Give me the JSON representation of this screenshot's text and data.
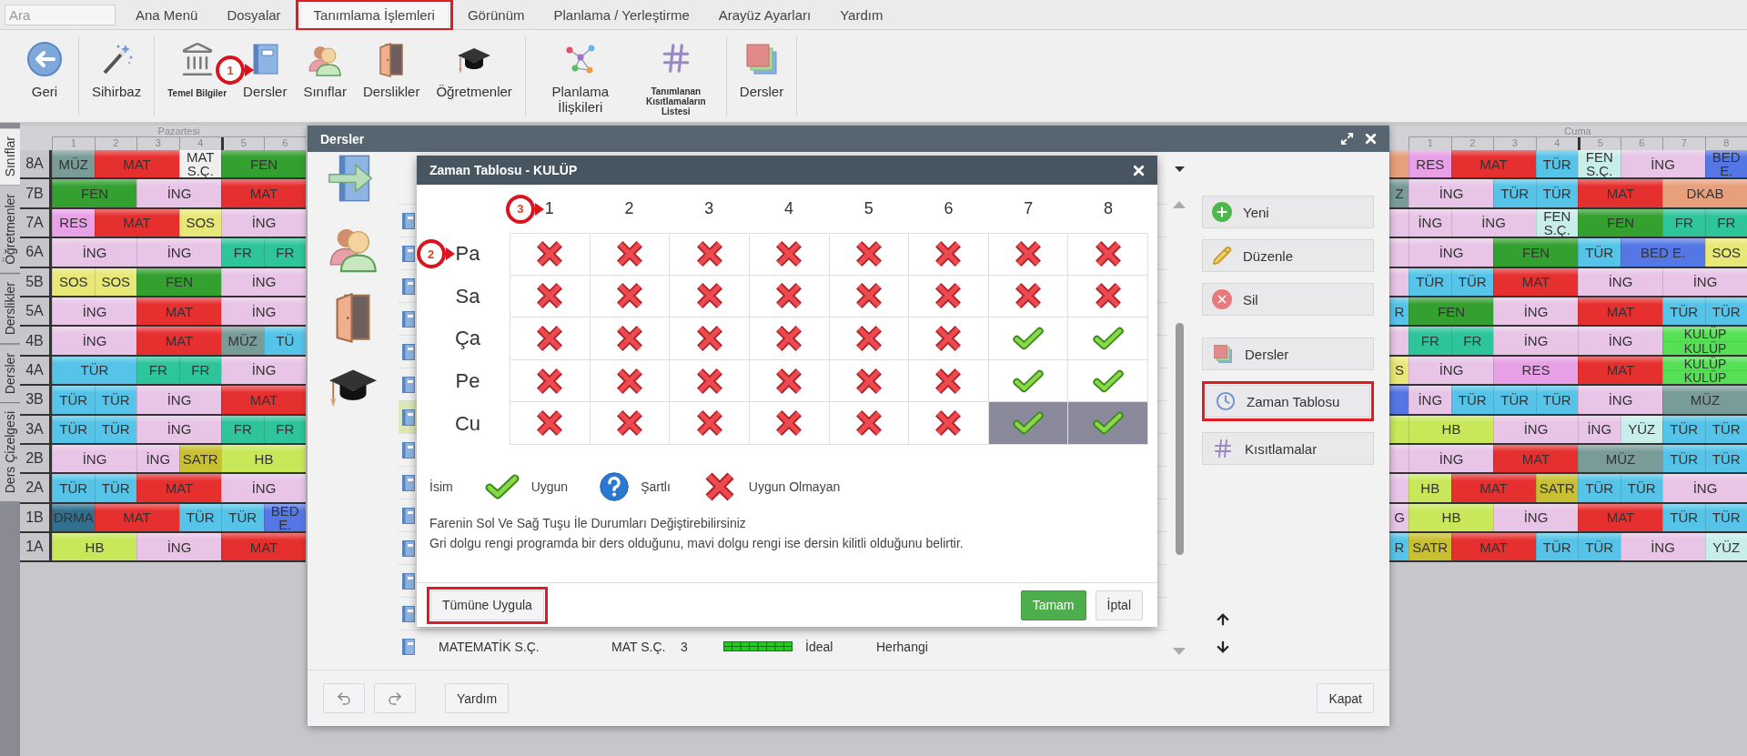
{
  "menu": {
    "search": {
      "placeholder": "Ara"
    },
    "items": [
      {
        "label": "Ana Menü",
        "selected": false,
        "highlighted": false
      },
      {
        "label": "Dosyalar",
        "selected": false,
        "highlighted": false
      },
      {
        "label": "Tanımlama İşlemleri",
        "selected": true,
        "highlighted": true
      },
      {
        "label": "Görünüm",
        "selected": false,
        "highlighted": false
      },
      {
        "label": "Planlama / Yerleştirme",
        "selected": false,
        "highlighted": false
      },
      {
        "label": "Arayüz Ayarları",
        "selected": false,
        "highlighted": false
      },
      {
        "label": "Yardım",
        "selected": false,
        "highlighted": false
      }
    ]
  },
  "toolbar": {
    "groups": [
      {
        "items": [
          {
            "label": "Geri",
            "kind": "back"
          }
        ]
      },
      {
        "items": [
          {
            "label": "Sihirbaz",
            "kind": "wizard"
          }
        ]
      },
      {
        "items": [
          {
            "label": "Temel Bilgiler",
            "kind": "institution",
            "compact": true
          },
          {
            "label": "Dersler",
            "kind": "book",
            "marker": "1"
          },
          {
            "label": "Sınıflar",
            "kind": "people"
          },
          {
            "label": "Derslikler",
            "kind": "door"
          },
          {
            "label": "Öğretmenler",
            "kind": "cap"
          }
        ]
      },
      {
        "items": [
          {
            "label": "Planlama İlişkileri",
            "kind": "network"
          },
          {
            "label": "Tanımlanan Kısıtlamaların Listesi",
            "kind": "grid",
            "compact": true
          }
        ]
      },
      {
        "items": [
          {
            "label": "Dersler",
            "kind": "stack"
          }
        ]
      }
    ]
  },
  "side_tabs": [
    {
      "label": "Sınıflar",
      "selected": true
    },
    {
      "label": "Öğretmenler",
      "selected": false
    },
    {
      "label": "Derslikler",
      "selected": false
    },
    {
      "label": "Dersler",
      "selected": false
    },
    {
      "label": "Ders Çizelgesi",
      "selected": false
    }
  ],
  "timetable": {
    "days": [
      {
        "name": "Pazartesi",
        "periods": [
          "1",
          "2",
          "3",
          "4",
          "5",
          "6"
        ]
      },
      {
        "name": "Cuma",
        "periods": [
          "1",
          "2",
          "3",
          "4",
          "5",
          "6",
          "7",
          "8"
        ]
      }
    ],
    "rows": [
      {
        "class": "8A",
        "pazartesi": [
          {
            "text": "MÜZ",
            "color": "#7a9c98",
            "kind": "single"
          },
          {
            "text": "MAT",
            "color": "#e63030",
            "kind": "double"
          },
          {
            "text": "MAT S.Ç.",
            "color": "#efefef",
            "kind": "single"
          },
          {
            "text": "FEN",
            "color": "#33a02f",
            "kind": "double"
          }
        ],
        "partial": {
          "color": "#e8a07c"
        },
        "cuma": [
          {
            "text": "RES",
            "color": "#e8a0e6",
            "kind": "single"
          },
          {
            "text": "MAT",
            "color": "#e63030",
            "kind": "double"
          },
          {
            "text": "TÜR",
            "color": "#55c4e8",
            "kind": "single"
          },
          {
            "text": "FEN S.Ç.",
            "color": "#c8eeea",
            "kind": "single"
          },
          {
            "text": "İNG",
            "color": "#e8c4e6",
            "kind": "double"
          },
          {
            "text": "BED E.",
            "color": "#5577e6",
            "kind": "single"
          }
        ]
      },
      {
        "class": "7B",
        "pazartesi": [
          {
            "text": "FEN",
            "color": "#33a02f",
            "kind": "double"
          },
          {
            "text": "İNG",
            "color": "#e8c4e6",
            "kind": "double"
          },
          {
            "text": "MAT",
            "color": "#e63030",
            "kind": "double"
          }
        ],
        "partial": {
          "text": "Z",
          "color": "#7a9c98"
        },
        "cuma": [
          {
            "text": "İNG",
            "color": "#e8c4e6",
            "kind": "double"
          },
          {
            "text": "TÜR",
            "color": "#55c4e8",
            "kind": "single"
          },
          {
            "text": "TÜR",
            "color": "#55c4e8",
            "kind": "single"
          },
          {
            "text": "MAT",
            "color": "#e63030",
            "kind": "double"
          },
          {
            "text": "DKAB",
            "color": "#e8a07c",
            "kind": "double"
          }
        ]
      },
      {
        "class": "7A",
        "pazartesi": [
          {
            "text": "RES",
            "color": "#e8a0e6",
            "kind": "single"
          },
          {
            "text": "MAT",
            "color": "#e63030",
            "kind": "double"
          },
          {
            "text": "SOS",
            "color": "#e8e878",
            "kind": "single"
          },
          {
            "text": "İNG",
            "color": "#e8c4e6",
            "kind": "double"
          }
        ],
        "partial": {
          "color": "#e8c4e6"
        },
        "cuma": [
          {
            "text": "İNG",
            "color": "#e8c4e6",
            "kind": "single"
          },
          {
            "text": "İNG",
            "color": "#e8c4e6",
            "kind": "double"
          },
          {
            "text": "FEN S.Ç.",
            "color": "#c8eeea",
            "kind": "single"
          },
          {
            "text": "FEN",
            "color": "#33a02f",
            "kind": "double"
          },
          {
            "text": "FR",
            "color": "#2ec49c",
            "kind": "single"
          },
          {
            "text": "FR",
            "color": "#2ec49c",
            "kind": "single"
          }
        ]
      },
      {
        "class": "6A",
        "pazartesi": [
          {
            "text": "İNG",
            "color": "#e8c4e6",
            "kind": "double"
          },
          {
            "text": "İNG",
            "color": "#e8c4e6",
            "kind": "double"
          },
          {
            "text": "FR",
            "color": "#2ec49c",
            "kind": "single"
          },
          {
            "text": "FR",
            "color": "#2ec49c",
            "kind": "single"
          }
        ],
        "partial": {
          "color": "#e8c4e6"
        },
        "cuma": [
          {
            "text": "İNG",
            "color": "#e8c4e6",
            "kind": "double"
          },
          {
            "text": "FEN",
            "color": "#33a02f",
            "kind": "double"
          },
          {
            "text": "TÜR",
            "color": "#55c4e8",
            "kind": "single"
          },
          {
            "text": "BED E.",
            "color": "#5577e6",
            "kind": "double"
          },
          {
            "text": "SOS",
            "color": "#e8e878",
            "kind": "single"
          }
        ]
      },
      {
        "class": "5B",
        "pazartesi": [
          {
            "text": "SOS",
            "color": "#e8e878",
            "kind": "single"
          },
          {
            "text": "SOS",
            "color": "#e8e878",
            "kind": "single"
          },
          {
            "text": "FEN",
            "color": "#33a02f",
            "kind": "double"
          },
          {
            "text": "İNG",
            "color": "#e8c4e6",
            "kind": "double"
          }
        ],
        "partial": {
          "color": "#e8c4e6"
        },
        "cuma": [
          {
            "text": "TÜR",
            "color": "#55c4e8",
            "kind": "single"
          },
          {
            "text": "TÜR",
            "color": "#55c4e8",
            "kind": "single"
          },
          {
            "text": "MAT",
            "color": "#e63030",
            "kind": "double"
          },
          {
            "text": "İNG",
            "color": "#e8c4e6",
            "kind": "double"
          },
          {
            "text": "İNG",
            "color": "#e8c4e6",
            "kind": "double"
          }
        ]
      },
      {
        "class": "5A",
        "pazartesi": [
          {
            "text": "İNG",
            "color": "#e8c4e6",
            "kind": "double"
          },
          {
            "text": "MAT",
            "color": "#e63030",
            "kind": "double"
          },
          {
            "text": "İNG",
            "color": "#e8c4e6",
            "kind": "double"
          }
        ],
        "partial": {
          "text": "R",
          "color": "#55c4e8"
        },
        "cuma": [
          {
            "text": "FEN",
            "color": "#33a02f",
            "kind": "double"
          },
          {
            "text": "İNG",
            "color": "#e8c4e6",
            "kind": "double"
          },
          {
            "text": "MAT",
            "color": "#e63030",
            "kind": "double"
          },
          {
            "text": "TÜR",
            "color": "#55c4e8",
            "kind": "single"
          },
          {
            "text": "TÜR",
            "color": "#55c4e8",
            "kind": "single"
          }
        ]
      },
      {
        "class": "4B",
        "pazartesi": [
          {
            "text": "İNG",
            "color": "#e8c4e6",
            "kind": "double"
          },
          {
            "text": "MAT",
            "color": "#e63030",
            "kind": "double"
          },
          {
            "text": "MÜZ",
            "color": "#7a9c98",
            "kind": "single"
          },
          {
            "text": "TÜ",
            "color": "#55c4e8",
            "kind": "single"
          }
        ],
        "partial": {
          "color": "#e8c4e6"
        },
        "cuma": [
          {
            "text": "FR",
            "color": "#2ec49c",
            "kind": "single"
          },
          {
            "text": "FR",
            "color": "#2ec49c",
            "kind": "single"
          },
          {
            "text": "İNG",
            "color": "#e8c4e6",
            "kind": "double"
          },
          {
            "text": "İNG",
            "color": "#e8c4e6",
            "kind": "double"
          },
          {
            "texts": [
              "KULÜP",
              "KULÜP"
            ],
            "color": "#55e055",
            "kind": "stacked"
          }
        ]
      },
      {
        "class": "4A",
        "pazartesi": [
          {
            "text": "TÜR",
            "color": "#55c4e8",
            "kind": "double"
          },
          {
            "text": "FR",
            "color": "#2ec49c",
            "kind": "single"
          },
          {
            "text": "FR",
            "color": "#2ec49c",
            "kind": "single"
          },
          {
            "text": "İNG",
            "color": "#e8c4e6",
            "kind": "double"
          }
        ],
        "partial": {
          "text": "S",
          "color": "#e8e878"
        },
        "cuma": [
          {
            "text": "İNG",
            "color": "#e8c4e6",
            "kind": "double"
          },
          {
            "text": "RES",
            "color": "#e8a0e6",
            "kind": "double"
          },
          {
            "text": "MAT",
            "color": "#e63030",
            "kind": "double"
          },
          {
            "texts": [
              "KULÜP",
              "KULÜP"
            ],
            "color": "#55e055",
            "kind": "stacked"
          }
        ]
      },
      {
        "class": "3B",
        "pazartesi": [
          {
            "text": "TÜR",
            "color": "#55c4e8",
            "kind": "single"
          },
          {
            "text": "TÜR",
            "color": "#55c4e8",
            "kind": "single"
          },
          {
            "text": "İNG",
            "color": "#e8c4e6",
            "kind": "double"
          },
          {
            "text": "MAT",
            "color": "#e63030",
            "kind": "double"
          }
        ],
        "partial": {
          "color": "#5577e6"
        },
        "cuma": [
          {
            "text": "İNG",
            "color": "#e8c4e6",
            "kind": "single"
          },
          {
            "text": "TÜR",
            "color": "#55c4e8",
            "kind": "single"
          },
          {
            "text": "TÜR",
            "color": "#55c4e8",
            "kind": "single"
          },
          {
            "text": "TÜR",
            "color": "#55c4e8",
            "kind": "single"
          },
          {
            "text": "İNG",
            "color": "#e8c4e6",
            "kind": "double"
          },
          {
            "text": "MÜZ",
            "color": "#7a9c98",
            "kind": "double"
          }
        ]
      },
      {
        "class": "3A",
        "pazartesi": [
          {
            "text": "TÜR",
            "color": "#55c4e8",
            "kind": "single"
          },
          {
            "text": "TÜR",
            "color": "#55c4e8",
            "kind": "single"
          },
          {
            "text": "İNG",
            "color": "#e8c4e6",
            "kind": "double"
          },
          {
            "text": "FR",
            "color": "#2ec49c",
            "kind": "single"
          },
          {
            "text": "FR",
            "color": "#2ec49c",
            "kind": "single"
          }
        ],
        "partial": {
          "color": "#c8e85a"
        },
        "cuma": [
          {
            "text": "HB",
            "color": "#c8e85a",
            "kind": "double"
          },
          {
            "text": "İNG",
            "color": "#e8c4e6",
            "kind": "double"
          },
          {
            "text": "İNG",
            "color": "#e8c4e6",
            "kind": "single"
          },
          {
            "text": "YÜZ",
            "color": "#c8eeea",
            "kind": "single"
          },
          {
            "text": "TÜR",
            "color": "#55c4e8",
            "kind": "single"
          },
          {
            "text": "TÜR",
            "color": "#55c4e8",
            "kind": "single"
          }
        ]
      },
      {
        "class": "2B",
        "pazartesi": [
          {
            "text": "İNG",
            "color": "#e8c4e6",
            "kind": "double"
          },
          {
            "text": "İNG",
            "color": "#e8c4e6",
            "kind": "single"
          },
          {
            "text": "SATR",
            "color": "#c8c030",
            "kind": "single"
          },
          {
            "text": "HB",
            "color": "#c8e85a",
            "kind": "double"
          }
        ],
        "partial": {
          "color": "#e8c4e6"
        },
        "cuma": [
          {
            "text": "İNG",
            "color": "#e8c4e6",
            "kind": "double"
          },
          {
            "text": "MAT",
            "color": "#e63030",
            "kind": "double"
          },
          {
            "text": "MÜZ",
            "color": "#7a9c98",
            "kind": "double"
          },
          {
            "text": "TÜR",
            "color": "#55c4e8",
            "kind": "single"
          },
          {
            "text": "TÜR",
            "color": "#55c4e8",
            "kind": "single"
          }
        ]
      },
      {
        "class": "2A",
        "pazartesi": [
          {
            "text": "TÜR",
            "color": "#55c4e8",
            "kind": "single"
          },
          {
            "text": "TÜR",
            "color": "#55c4e8",
            "kind": "single"
          },
          {
            "text": "MAT",
            "color": "#e63030",
            "kind": "double"
          },
          {
            "text": "İNG",
            "color": "#e8c4e6",
            "kind": "double"
          }
        ],
        "partial": {
          "color": "#e8c4e6"
        },
        "cuma": [
          {
            "text": "HB",
            "color": "#c8e85a",
            "kind": "single"
          },
          {
            "text": "MAT",
            "color": "#e63030",
            "kind": "double"
          },
          {
            "text": "SATR",
            "color": "#c8c030",
            "kind": "single"
          },
          {
            "text": "TÜR",
            "color": "#55c4e8",
            "kind": "single"
          },
          {
            "text": "TÜR",
            "color": "#55c4e8",
            "kind": "single"
          },
          {
            "text": "İNG",
            "color": "#e8c4e6",
            "kind": "double"
          }
        ]
      },
      {
        "class": "1B",
        "pazartesi": [
          {
            "text": "DRMA",
            "color": "#2f6f8f",
            "kind": "single"
          },
          {
            "text": "MAT",
            "color": "#e63030",
            "kind": "double"
          },
          {
            "text": "TÜR",
            "color": "#55c4e8",
            "kind": "single"
          },
          {
            "text": "TÜR",
            "color": "#55c4e8",
            "kind": "single"
          },
          {
            "text": "BED E.",
            "color": "#5577e6",
            "kind": "single"
          }
        ],
        "partial": {
          "text": "G",
          "color": "#e8c4e6"
        },
        "cuma": [
          {
            "text": "HB",
            "color": "#c8e85a",
            "kind": "double"
          },
          {
            "text": "İNG",
            "color": "#e8c4e6",
            "kind": "double"
          },
          {
            "text": "MAT",
            "color": "#e63030",
            "kind": "double"
          },
          {
            "text": "TÜR",
            "color": "#55c4e8",
            "kind": "single"
          },
          {
            "text": "TÜR",
            "color": "#55c4e8",
            "kind": "single"
          }
        ]
      },
      {
        "class": "1A",
        "pazartesi": [
          {
            "text": "HB",
            "color": "#c8e85a",
            "kind": "double"
          },
          {
            "text": "İNG",
            "color": "#e8c4e6",
            "kind": "double"
          },
          {
            "text": "MAT",
            "color": "#e63030",
            "kind": "double"
          }
        ],
        "partial": {
          "text": "R",
          "color": "#55c4e8"
        },
        "cuma": [
          {
            "text": "SATR",
            "color": "#c8c030",
            "kind": "single"
          },
          {
            "text": "MAT",
            "color": "#e63030",
            "kind": "double"
          },
          {
            "text": "TÜR",
            "color": "#55c4e8",
            "kind": "single"
          },
          {
            "text": "TÜR",
            "color": "#55c4e8",
            "kind": "single"
          },
          {
            "text": "İNG",
            "color": "#e8c4e6",
            "kind": "double"
          },
          {
            "text": "YÜZ",
            "color": "#c8eeea",
            "kind": "single"
          }
        ]
      }
    ]
  },
  "dialog": {
    "title": "Dersler",
    "list": {
      "rows": [
        {
          "selected": false
        },
        {
          "selected": false
        },
        {
          "selected": false
        },
        {
          "selected": false
        },
        {
          "selected": false
        },
        {
          "selected": false
        },
        {
          "selected": true
        },
        {
          "selected": false
        },
        {
          "selected": false
        },
        {
          "selected": false
        },
        {
          "selected": false
        },
        {
          "selected": false
        },
        {
          "selected": false
        },
        {
          "selected": false,
          "name": "MATEMATİK S.Ç.",
          "code": "MAT S.Ç.",
          "count": "3",
          "placement": "İdeal",
          "room": "Herhangi"
        }
      ]
    },
    "actions": [
      {
        "label": "Yeni",
        "kind": "add",
        "highlighted": false
      },
      {
        "label": "Düzenle",
        "kind": "edit",
        "highlighted": false
      },
      {
        "label": "Sil",
        "kind": "delete",
        "highlighted": false
      }
    ],
    "views": [
      {
        "label": "Dersler",
        "kind": "stack",
        "highlighted": false
      },
      {
        "label": "Zaman Tablosu",
        "kind": "clock",
        "highlighted": true
      },
      {
        "label": "Kısıtlamalar",
        "kind": "grid",
        "highlighted": false
      }
    ],
    "footer": {
      "help": "Yardım",
      "close": "Kapat"
    }
  },
  "timetable_dialog": {
    "title": "Zaman Tablosu - KULÜP",
    "columns": [
      {
        "label": "1",
        "marker": "3"
      },
      {
        "label": "2"
      },
      {
        "label": "3"
      },
      {
        "label": "4"
      },
      {
        "label": "5"
      },
      {
        "label": "6"
      },
      {
        "label": "7"
      },
      {
        "label": "8"
      }
    ],
    "rows": [
      {
        "day": "Pa",
        "marker": "2",
        "slots": [
          {
            "available": false,
            "filled": false
          },
          {
            "available": false,
            "filled": false
          },
          {
            "available": false,
            "filled": false
          },
          {
            "available": false,
            "filled": false
          },
          {
            "available": false,
            "filled": false
          },
          {
            "available": false,
            "filled": false
          },
          {
            "available": false,
            "filled": false
          },
          {
            "available": false,
            "filled": false
          }
        ]
      },
      {
        "day": "Sa",
        "slots": [
          {
            "available": false,
            "filled": false
          },
          {
            "available": false,
            "filled": false
          },
          {
            "available": false,
            "filled": false
          },
          {
            "available": false,
            "filled": false
          },
          {
            "available": false,
            "filled": false
          },
          {
            "available": false,
            "filled": false
          },
          {
            "available": false,
            "filled": false
          },
          {
            "available": false,
            "filled": false
          }
        ]
      },
      {
        "day": "Ça",
        "slots": [
          {
            "available": false,
            "filled": false
          },
          {
            "available": false,
            "filled": false
          },
          {
            "available": false,
            "filled": false
          },
          {
            "available": false,
            "filled": false
          },
          {
            "available": false,
            "filled": false
          },
          {
            "available": false,
            "filled": false
          },
          {
            "available": true,
            "filled": false
          },
          {
            "available": true,
            "filled": false
          }
        ]
      },
      {
        "day": "Pe",
        "slots": [
          {
            "available": false,
            "filled": false
          },
          {
            "available": false,
            "filled": false
          },
          {
            "available": false,
            "filled": false
          },
          {
            "available": false,
            "filled": false
          },
          {
            "available": false,
            "filled": false
          },
          {
            "available": false,
            "filled": false
          },
          {
            "available": true,
            "filled": false
          },
          {
            "available": true,
            "filled": false
          }
        ]
      },
      {
        "day": "Cu",
        "slots": [
          {
            "available": false,
            "filled": false
          },
          {
            "available": false,
            "filled": false
          },
          {
            "available": false,
            "filled": false
          },
          {
            "available": false,
            "filled": false
          },
          {
            "available": false,
            "filled": false
          },
          {
            "available": false,
            "filled": false
          },
          {
            "available": true,
            "filled": true
          },
          {
            "available": true,
            "filled": true
          }
        ]
      }
    ],
    "legend": {
      "label": "İsim",
      "items": [
        {
          "kind": "available",
          "text": "Uygun"
        },
        {
          "kind": "conditional",
          "text": "Şartlı"
        },
        {
          "kind": "unavailable",
          "text": "Uygun Olmayan"
        }
      ]
    },
    "notes": [
      "Farenin Sol Ve Sağ Tuşu İle Durumları Değiştirebilirsiniz",
      "Gri dolgu rengi programda bir ders olduğunu, mavi dolgu rengi ise dersin kilitli olduğunu belirtir."
    ],
    "apply_all": {
      "label": "Tümüne Uygula",
      "highlighted": true
    },
    "ok": "Tamam",
    "cancel": "İptal"
  }
}
